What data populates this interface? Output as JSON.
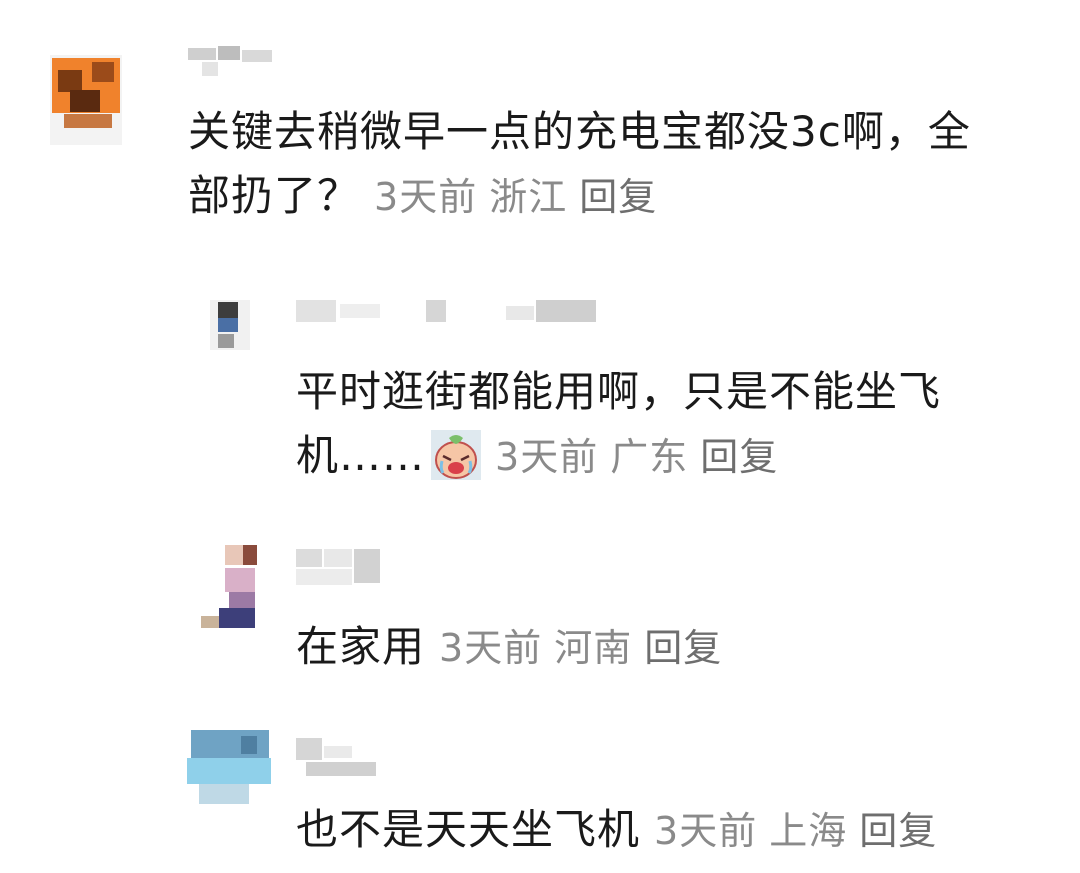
{
  "comments": [
    {
      "text_line1": "关键去稍微早一点的充电宝都没3c啊，全",
      "text_line2": "部扔了？",
      "time": "3天前",
      "location": "浙江",
      "reply": "回复"
    },
    {
      "text_line1": "平时逛街都能用啊，只是不能坐飞",
      "text_line2": "机……",
      "emoji": "crying-face-icon",
      "time": "3天前",
      "location": "广东",
      "reply": "回复"
    },
    {
      "text_line1": "在家用",
      "time": "3天前",
      "location": "河南",
      "reply": "回复"
    },
    {
      "text_line1": "也不是天天坐飞机",
      "time": "3天前",
      "location": "上海",
      "reply": "回复"
    }
  ]
}
